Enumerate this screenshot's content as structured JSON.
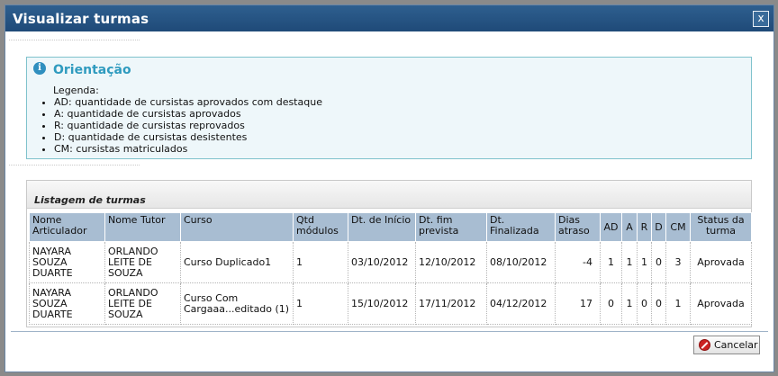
{
  "dialog": {
    "title": "Visualizar turmas",
    "close_label": "x"
  },
  "orientation": {
    "heading": "Orientação",
    "legend_title": "Legenda:",
    "items": [
      "AD: quantidade de cursistas aprovados com destaque",
      "A: quantidade de cursistas aprovados",
      "R: quantidade de cursistas reprovados",
      "D: quantidade de cursistas desistentes",
      "CM: cursistas matriculados"
    ]
  },
  "listing": {
    "title": "Listagem de turmas",
    "columns": [
      "Nome Articulador",
      "Nome Tutor",
      "Curso",
      "Qtd módulos",
      "Dt. de Início",
      "Dt. fim prevista",
      "Dt. Finalizada",
      "Dias atraso",
      "AD",
      "A",
      "R",
      "D",
      "CM",
      "Status da turma"
    ],
    "rows": [
      [
        "NAYARA SOUZA DUARTE",
        "ORLANDO LEITE DE SOUZA",
        "Curso Duplicado1",
        "1",
        "03/10/2012",
        "12/10/2012",
        "08/10/2012",
        "-4",
        "1",
        "1",
        "1",
        "0",
        "3",
        "Aprovada"
      ],
      [
        "NAYARA SOUZA DUARTE",
        "ORLANDO LEITE DE SOUZA",
        "Curso Com Cargaaa...editado (1)",
        "1",
        "15/10/2012",
        "17/11/2012",
        "04/12/2012",
        "17",
        "0",
        "1",
        "0",
        "0",
        "1",
        "Aprovada"
      ]
    ]
  },
  "footer": {
    "cancel_label": "Cancelar"
  },
  "colors": {
    "titlebar": "#2e5f8f",
    "header_row": "#a8bdd2",
    "orientation_border": "#7fc2cc",
    "orientation_heading": "#2f9bbf"
  }
}
